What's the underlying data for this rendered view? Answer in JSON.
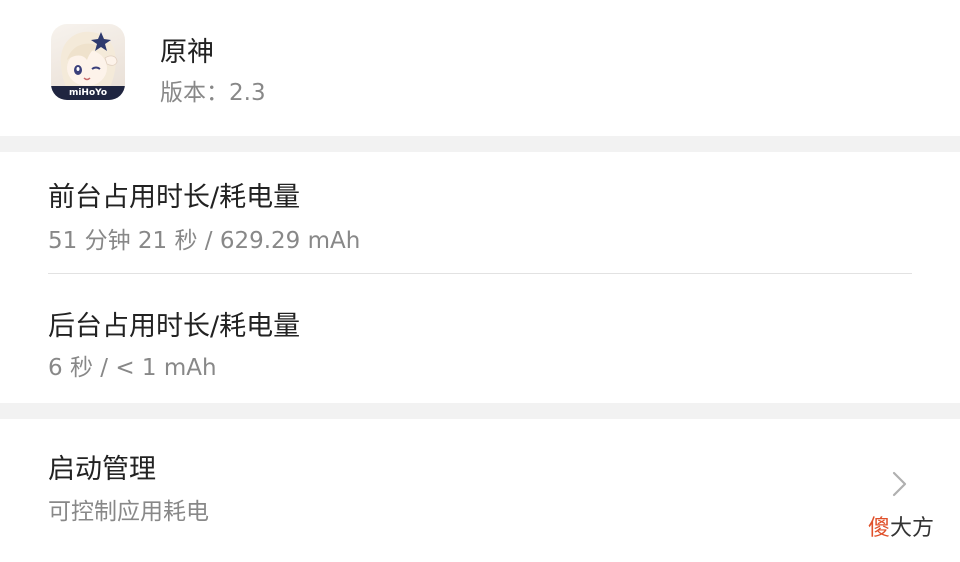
{
  "app": {
    "name": "原神",
    "version": "版本：2.3",
    "icon_brand": "miHoYo"
  },
  "foreground": {
    "title": "前台占用时长/耗电量",
    "value": "51 分钟 21 秒 / 629.29 mAh"
  },
  "background": {
    "title": "后台占用时长/耗电量",
    "value": "6 秒 / < 1 mAh"
  },
  "launch": {
    "title": "启动管理",
    "subtitle": "可控制应用耗电",
    "chevron_icon": "chevron-right-icon"
  },
  "watermark": {
    "char1": "傻",
    "rest": "大方"
  },
  "colors": {
    "background": "#ffffff",
    "separator": "#f2f2f2",
    "title_text": "#222222",
    "secondary_text": "#888888",
    "watermark_accent": "#e0502a"
  }
}
